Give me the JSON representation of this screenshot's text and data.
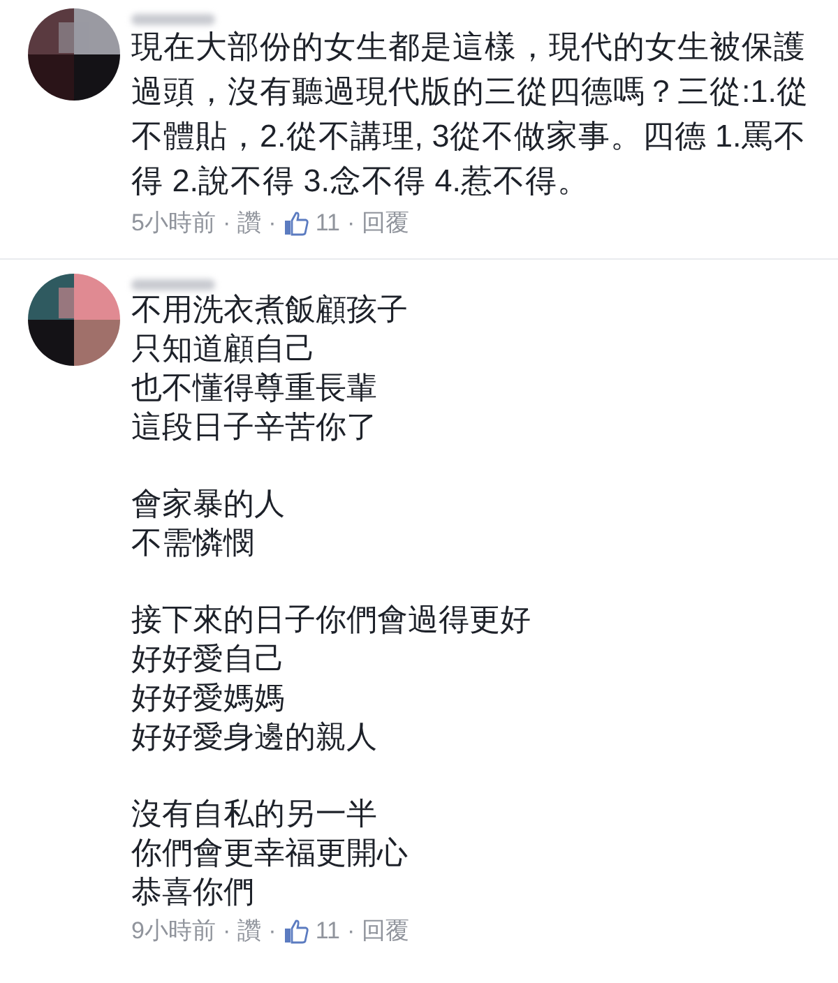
{
  "comments": [
    {
      "text": "現在大部份的女生都是這樣，現代的女生被保護過頭，沒有聽過現代版的三從四德嗎？三從:1.從不體貼，2.從不講理, 3從不做家事。四德 1.罵不得 2.說不得 3.念不得 4.惹不得。",
      "meta": {
        "time": "5小時前",
        "separator": "·",
        "like": "讚",
        "likes": "11",
        "reply": "回覆"
      }
    },
    {
      "paragraphs": [
        [
          "不用洗衣煮飯顧孩子",
          "只知道顧自己",
          "也不懂得尊重長輩",
          "這段日子辛苦你了"
        ],
        [
          "會家暴的人",
          "不需憐憫"
        ],
        [
          "接下來的日子你們會過得更好",
          "好好愛自己",
          "好好愛媽媽",
          "好好愛身邊的親人"
        ],
        [
          "沒有自私的另一半",
          "你們會更幸福更開心",
          "恭喜你們"
        ]
      ],
      "meta": {
        "time": "9小時前",
        "separator": "·",
        "like": "讚",
        "likes": "11",
        "reply": "回覆"
      }
    }
  ]
}
